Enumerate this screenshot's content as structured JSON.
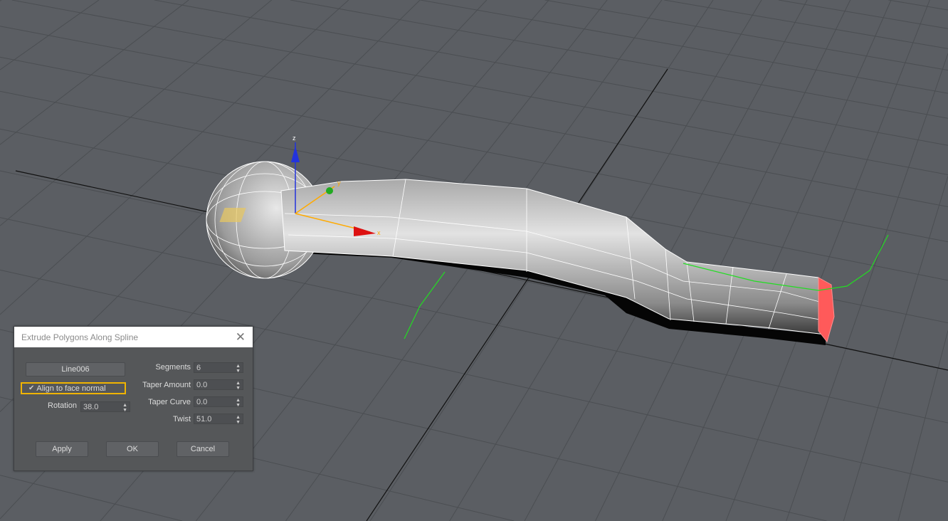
{
  "dialog": {
    "title": "Extrude Polygons Along Spline",
    "close_icon": "close-icon",
    "spline_button": "Line006",
    "align_checkbox": {
      "label": "Align to face normal",
      "checked": true
    },
    "rotation": {
      "label": "Rotation",
      "value": "38.0"
    },
    "segments": {
      "label": "Segments",
      "value": "6"
    },
    "taper_amount": {
      "label": "Taper Amount",
      "value": "0.0"
    },
    "taper_curve": {
      "label": "Taper Curve",
      "value": "0.0"
    },
    "twist": {
      "label": "Twist",
      "value": "51.0"
    },
    "buttons": {
      "apply": "Apply",
      "ok": "OK",
      "cancel": "Cancel"
    }
  },
  "gizmo": {
    "x": "x",
    "y": "y",
    "z": "z"
  },
  "colors": {
    "viewport_bg": "#5b5e63",
    "grid": "#4b4e52",
    "selection": "#ff5a5a",
    "spline": "#22dd22",
    "highlight": "#f0b400"
  }
}
